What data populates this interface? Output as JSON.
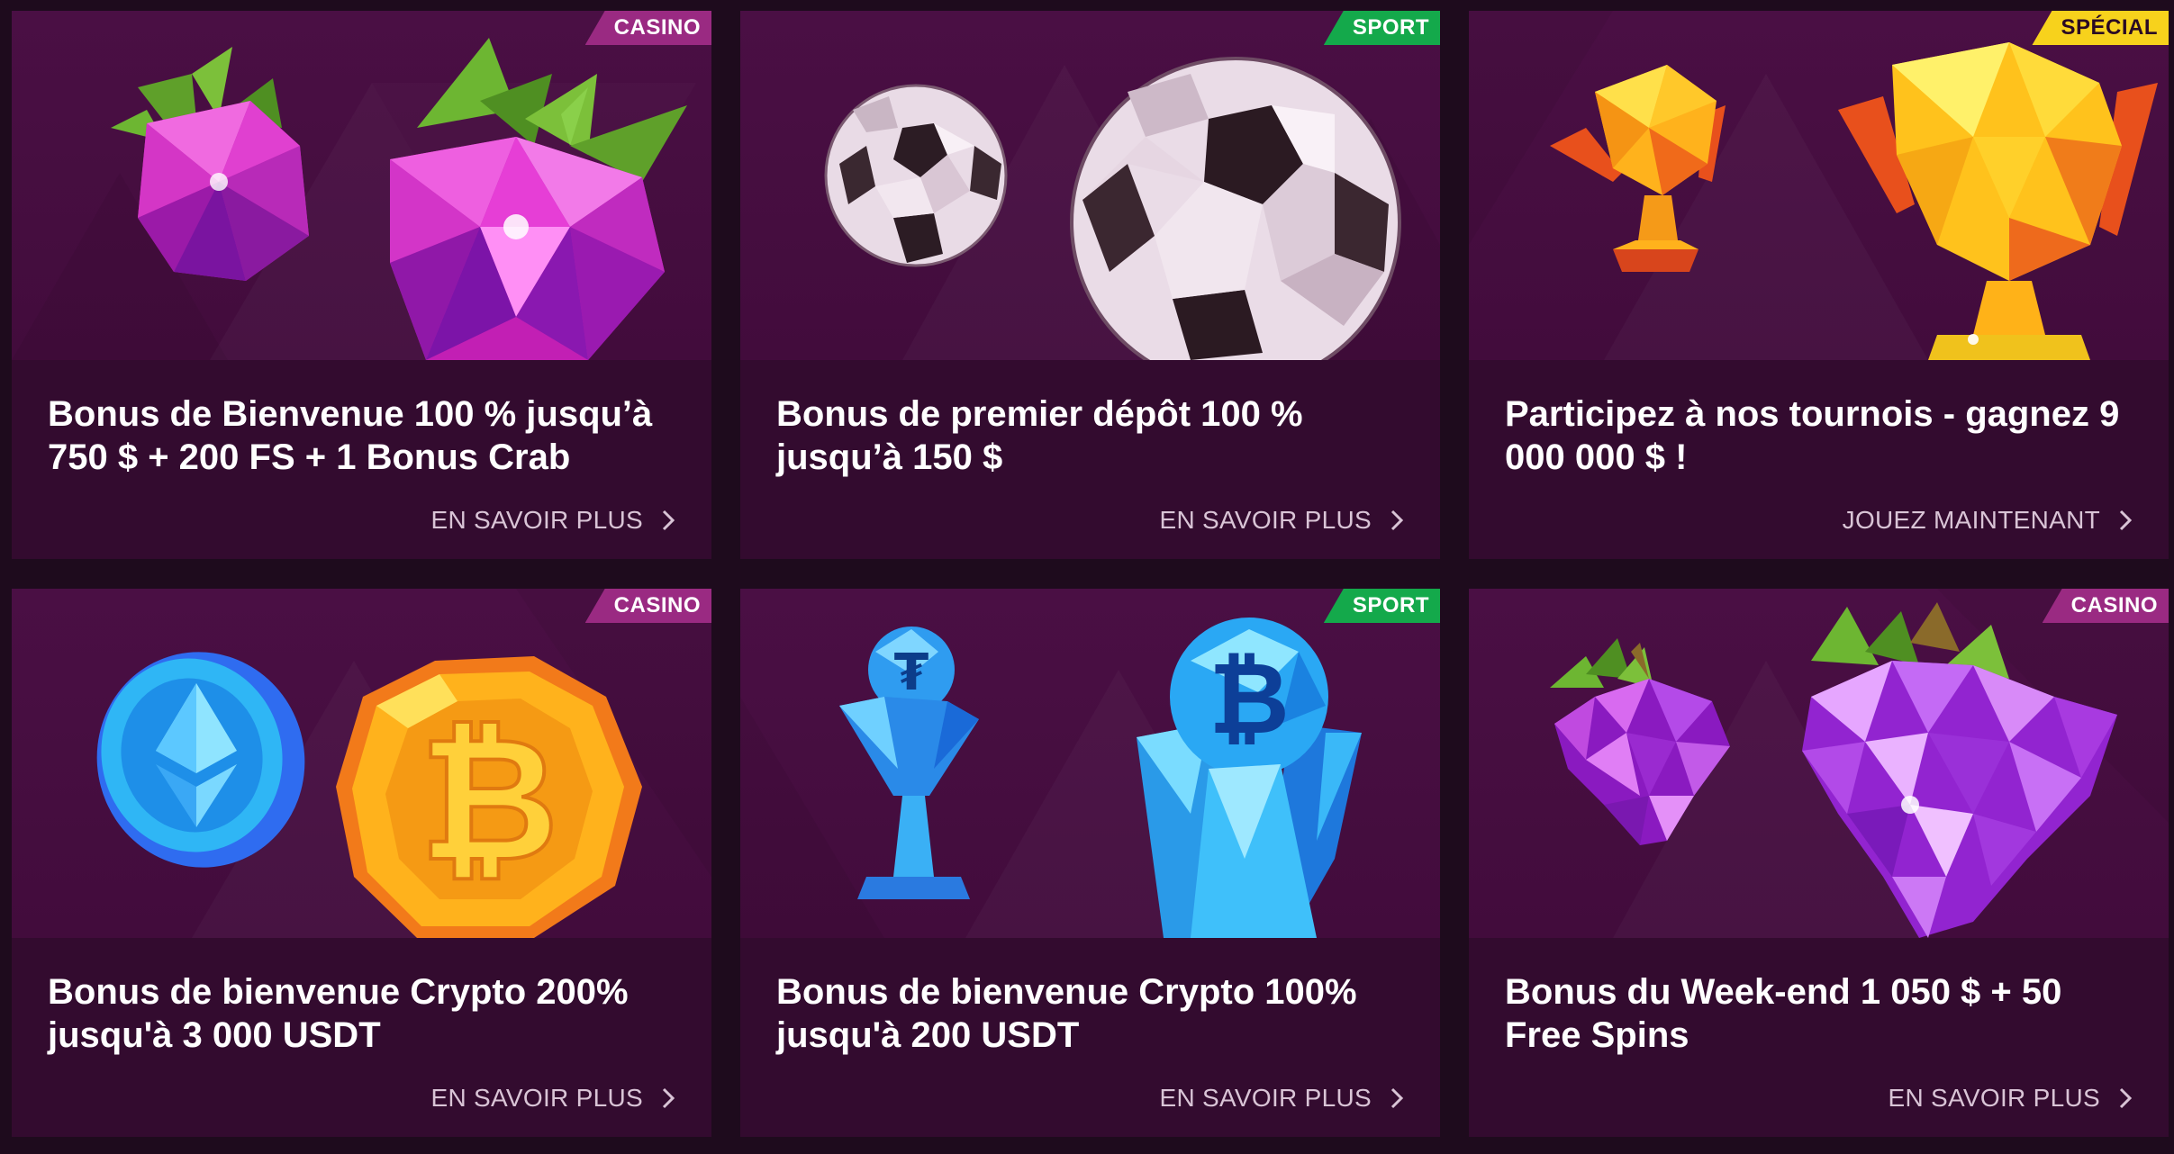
{
  "colors": {
    "casino": "#9a2a82",
    "sport": "#14a94b",
    "special": "#f7d21c",
    "special_text": "#2a0a24"
  },
  "cards": [
    {
      "badge": "CASINO",
      "badge_type": "casino",
      "art": "raspberry-gems",
      "title": "Bonus de Bienvenue 100 % jusqu’à 750 $ + 200 FS + 1 Bonus Crab",
      "cta": "EN SAVOIR PLUS"
    },
    {
      "badge": "SPORT",
      "badge_type": "sport",
      "art": "soccer-balls",
      "title": "Bonus de premier dépôt 100 % jusqu’à 150 $",
      "cta": "EN SAVOIR PLUS"
    },
    {
      "badge": "SPÉCIAL",
      "badge_type": "special",
      "art": "golden-trophies",
      "title": "Participez à nos tournois - gagnez 9 000 000 $ !",
      "cta": "JOUEZ MAINTENANT"
    },
    {
      "badge": "CASINO",
      "badge_type": "casino",
      "art": "crypto-coins",
      "title": "Bonus de bienvenue Crypto 200% jusqu'à 3 000 USDT",
      "cta": "EN SAVOIR PLUS"
    },
    {
      "badge": "SPORT",
      "badge_type": "sport",
      "art": "crystal-crypto-trophies",
      "title": "Bonus de bienvenue Crypto 100% jusqu'à 200 USDT",
      "cta": "EN SAVOIR PLUS"
    },
    {
      "badge": "CASINO",
      "badge_type": "casino",
      "art": "grape-gems",
      "title": "Bonus du Week-end 1 050 $ + 50 Free Spins",
      "cta": "EN SAVOIR PLUS"
    }
  ]
}
